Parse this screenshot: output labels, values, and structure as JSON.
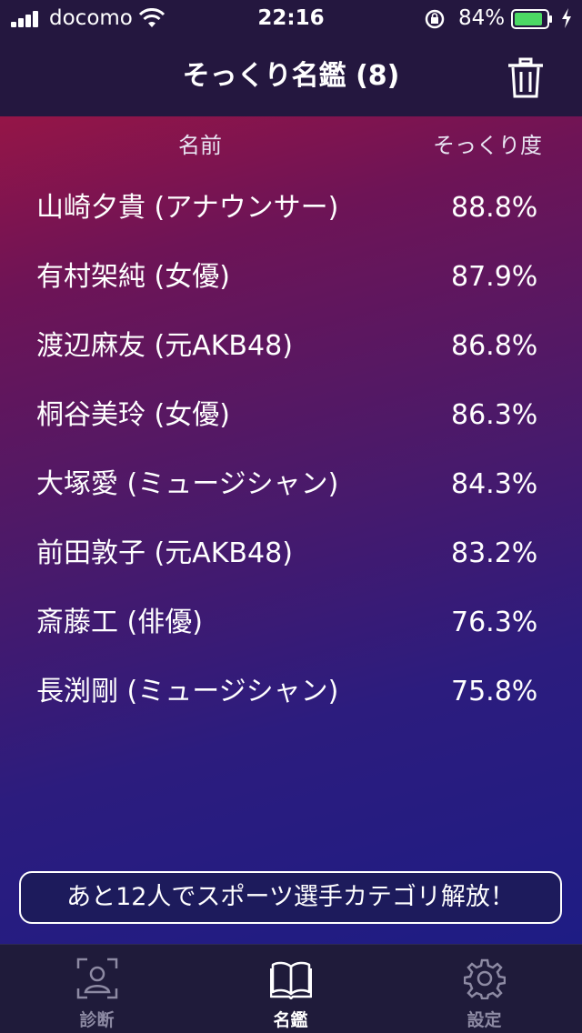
{
  "status_bar": {
    "carrier": "docomo",
    "time": "22:16",
    "battery_percent": "84%",
    "battery_color": "#4cd964"
  },
  "nav": {
    "title": "そっくり名鑑 (8)",
    "trash_icon": "trash-icon"
  },
  "table": {
    "header_name": "名前",
    "header_score": "そっくり度",
    "rows": [
      {
        "name": "山崎夕貴 (アナウンサー)",
        "score": "88.8%"
      },
      {
        "name": "有村架純 (女優)",
        "score": "87.9%"
      },
      {
        "name": "渡辺麻友 (元AKB48)",
        "score": "86.8%"
      },
      {
        "name": "桐谷美玲 (女優)",
        "score": "86.3%"
      },
      {
        "name": "大塚愛 (ミュージシャン)",
        "score": "84.3%"
      },
      {
        "name": "前田敦子 (元AKB48)",
        "score": "83.2%"
      },
      {
        "name": "斎藤工 (俳優)",
        "score": "76.3%"
      },
      {
        "name": "長渕剛 (ミュージシャン)",
        "score": "75.8%"
      }
    ]
  },
  "banner": {
    "text": "あと12人でスポーツ選手カテゴリ解放！"
  },
  "tabs": [
    {
      "label": "診断",
      "icon": "face-scan-icon",
      "active": false
    },
    {
      "label": "名鑑",
      "icon": "open-book-icon",
      "active": true
    },
    {
      "label": "設定",
      "icon": "gear-icon",
      "active": false
    }
  ]
}
